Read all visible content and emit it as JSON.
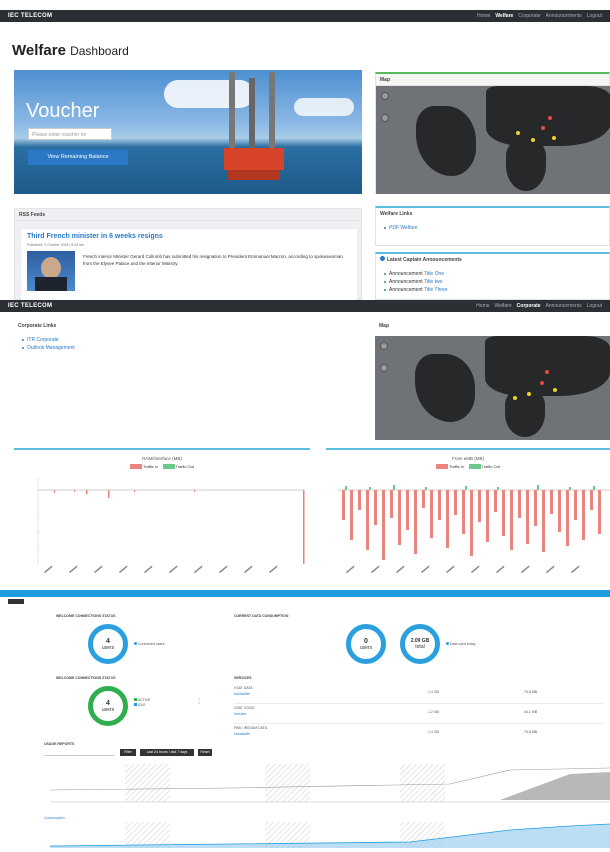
{
  "shot1": {
    "brand": "IEC TELECOM",
    "nav": [
      "Home",
      "Welfare",
      "Corporate",
      "Announcements",
      "Logout"
    ],
    "active": "Welfare",
    "page_title": "Welfare",
    "page_subtitle": "Dashboard",
    "voucher": {
      "title": "Voucher",
      "placeholder": "Please enter voucher no",
      "button": "View Remaining Balance"
    },
    "map_title": "Map",
    "rss": {
      "title": "RSS Feeds",
      "headline": "Third French minister in 6 weeks resigns",
      "byline": "Published: 3 October 2018 | 8:43 am",
      "body": "French interior Minister Gerard Collomb has submitted his resignation to President Emmanuel Macron, according to spokeswoman from the Elysee Palace and the Interior Ministry."
    },
    "welfare_links": {
      "title": "Welfare Links",
      "items": [
        "PDF Welfare"
      ]
    },
    "announcements": {
      "title": "Latest Captain Announcements",
      "prefix": "Announcement",
      "items": [
        "Title One",
        "Title two",
        "Title Three"
      ]
    }
  },
  "shot2": {
    "brand": "IEC TELECOM",
    "nav": [
      "Home",
      "Welfare",
      "Corporate",
      "Announcements",
      "Logout"
    ],
    "active": "Corporate",
    "corporate_links": {
      "title": "Corporate Links",
      "items": [
        "ITR Corporate",
        "Outlook Management"
      ]
    },
    "map_title": "Map",
    "chart_left_title": "RAM/Interface (MB)",
    "chart_right_title": "From eMB (MB)",
    "legend": [
      "Traffic In",
      "Traffic Out"
    ]
  },
  "shot3": {
    "title_a": "WELCOME CONNECTIONS STATUS",
    "ring_a": {
      "value": "4",
      "unit": "users",
      "legend": "Connected users"
    },
    "title_b": "CURRENT DATA CONSUMPTION",
    "ring_b": {
      "value": "0",
      "unit": "users"
    },
    "ring_c": {
      "value": "2.09 GB",
      "unit": "total",
      "legend": "Data used today"
    },
    "title_c": "WELCOME CONNECTIONS STATUS",
    "ring_d": {
      "value": "4",
      "unit": "users",
      "legend": [
        "ACTIVE",
        "IDLE"
      ]
    },
    "usage_title": "SERVICES",
    "usage_rows": [
      {
        "name": "VSAT DATA",
        "link": "bandwidth",
        "v1": "1.4 GB",
        "v2": "76.8 MB"
      },
      {
        "name": "VSAT VOICE",
        "link": "minutes",
        "v1": "1.2 GB",
        "v2": "44.1 MB"
      },
      {
        "name": "FBB / IRIDIUM DATA",
        "link": "bandwidth",
        "v1": "1.4 GB",
        "v2": "76.8 MB"
      }
    ],
    "filter_title": "USAGE REPORTS",
    "buttons": [
      "Filter",
      "Last 24 hours / last 7 days",
      "Reset"
    ],
    "area_legend": "Consumption"
  },
  "colors": {
    "nav": "#2b2f33",
    "accent": "#5bc0de",
    "in": "#e8857e",
    "out": "#6cc88a",
    "ring": "#2aa0df",
    "green": "#2fae4f",
    "blue": "#1f9be0"
  }
}
